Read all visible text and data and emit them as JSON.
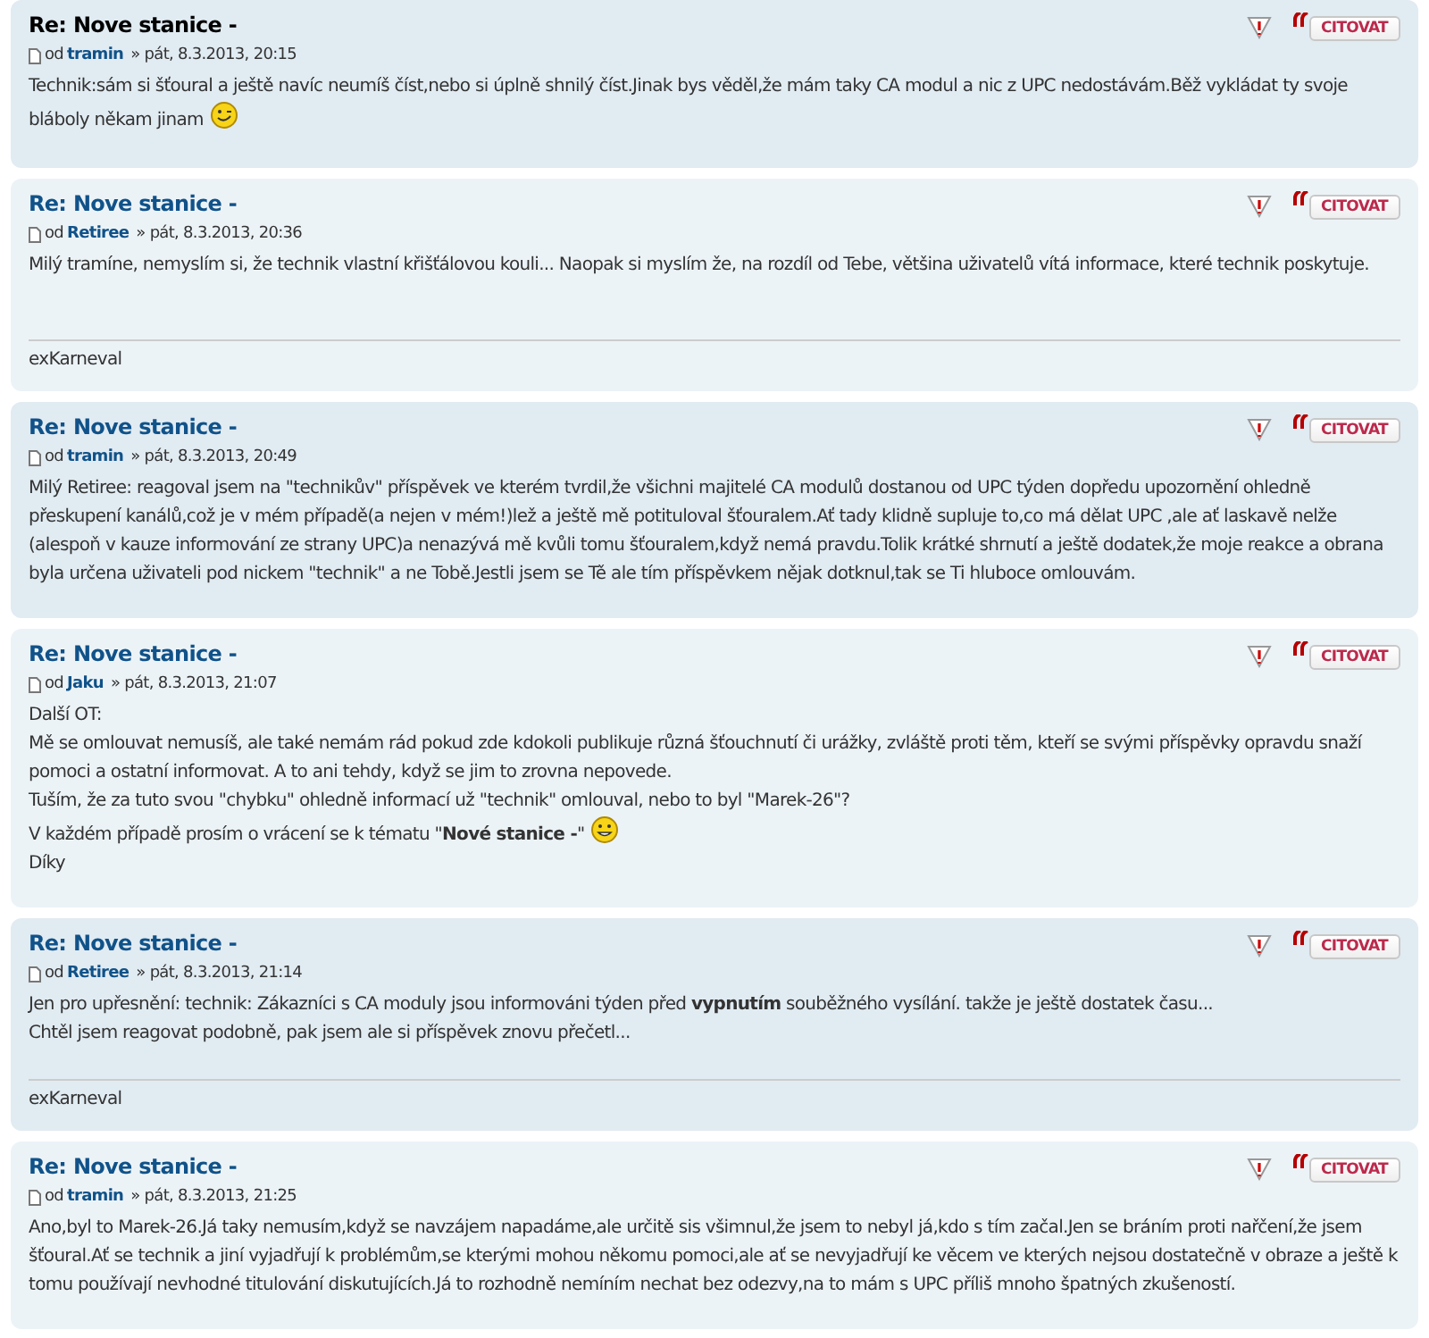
{
  "posts": [
    {
      "title": "Re: Nove stanice -",
      "title_active": true,
      "by": "od",
      "author": "tramin",
      "date": "» pát, 8.3.2013, 20:15",
      "quote_button": "CITOVAT",
      "body": [
        {
          "text": "Technik:sám si šťoural a ještě navíc neumíš číst,nebo si úplně shnilý číst.Jinak bys věděl,že mám taky CA modul a nic z UPC nedostávám.Běž vykládat ty svoje bláboly někam jinam",
          "kind": "wink"
        }
      ]
    },
    {
      "title": "Re: Nove stanice -",
      "title_active": false,
      "by": "od",
      "author": "Retiree",
      "date": "» pát, 8.3.2013, 20:36",
      "quote_button": "CITOVAT",
      "body": [
        {
          "text": "Milý tramíne, nemyslím si, že technik vlastní křišťálovou kouli... Naopak si myslím že, na rozdíl od Tebe, většina uživatelů vítá informace, které technik poskytuje."
        }
      ],
      "signature": "exKarneval"
    },
    {
      "title": "Re: Nove stanice -",
      "title_active": false,
      "by": "od",
      "author": "tramin",
      "date": "» pát, 8.3.2013, 20:49",
      "quote_button": "CITOVAT",
      "body": [
        {
          "text": "Milý Retiree: reagoval jsem na \"technikův\" příspěvek ve kterém tvrdil,že všichni majitelé CA modulů dostanou od UPC týden dopředu upozornění ohledně přeskupení kanálů,což je v mém případě(a nejen v mém!)lež a ještě mě potituloval šťouralem.Ať tady klidně supluje to,co má dělat UPC ,ale ať laskavě nelže (alespoň v kauze informování ze strany UPC)a nenazývá mě kvůli tomu šťouralem,když nemá pravdu.Tolik krátké shrnutí a ještě dodatek,že moje reakce a obrana byla určena uživateli pod nickem \"technik\" a ne Tobě.Jestli jsem se Tě ale tím příspěvkem nějak dotknul,tak se Ti hluboce omlouvám."
        }
      ]
    },
    {
      "title": "Re: Nove stanice -",
      "title_active": false,
      "by": "od",
      "author": "Jaku",
      "date": "» pát, 8.3.2013, 21:07",
      "quote_button": "CITOVAT",
      "body": [
        {
          "text": "Další OT:"
        },
        {
          "text": "Mě se omlouvat nemusíš, ale také nemám rád pokud zde kdokoli publikuje různá šťouchnutí či urážky, zvláště proti těm, kteří se svými příspěvky opravdu snaží pomoci a ostatní informovat. A to ani tehdy, když se jim to zrovna nepovede."
        },
        {
          "text": "Tuším, že za tuto svou \"chybku\" ohledně informací už \"technik\" omlouval, nebo to byl \"Marek-26\"?"
        },
        {
          "text": "V každém případě prosím o vrácení se k tématu \"**Nové stanice -**\"",
          "kind": "smile"
        },
        {
          "text": "Díky"
        }
      ]
    },
    {
      "title": "Re: Nove stanice -",
      "title_active": false,
      "by": "od",
      "author": "Retiree",
      "date": "» pát, 8.3.2013, 21:14",
      "quote_button": "CITOVAT",
      "body": [
        {
          "text": "Jen pro upřesnění: technik: Zákazníci s CA moduly jsou informováni týden před **vypnutím** souběžného vysílání. takže je ještě dostatek času..."
        },
        {
          "text": "Chtěl jsem reagovat podobně, pak jsem ale si příspěvek znovu přečetl..."
        }
      ],
      "signature": "exKarneval"
    },
    {
      "title": "Re: Nove stanice -",
      "title_active": false,
      "by": "od",
      "author": "tramin",
      "date": "» pát, 8.3.2013, 21:25",
      "quote_button": "CITOVAT",
      "body": [
        {
          "text": "Ano,byl to Marek-26.Já taky nemusím,když se navzájem napadáme,ale určitě sis všimnul,že jsem to nebyl já,kdo s tím začal.Jen se bráním proti nařčení,že jsem šťoural.Ať se technik a jiní vyjadřují k problémům,se kterými mohou někomu pomoci,ale ať se nevyjadřují ke věcem ve kterých nejsou dostatečně v obraze a ještě k tomu používají nevhodné titulování diskutujících.Já to rozhodně nemíním nechat bez odezvy,na to mám s UPC příliš mnoho špatných zkušeností."
        }
      ]
    }
  ]
}
